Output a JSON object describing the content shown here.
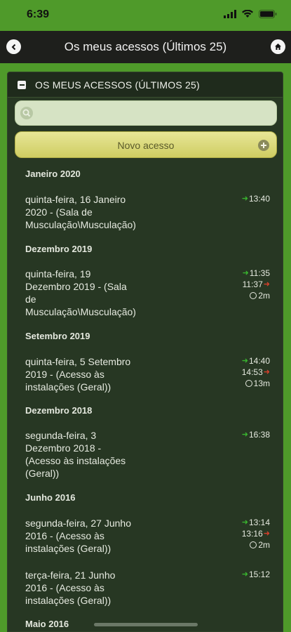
{
  "status": {
    "time": "6:39"
  },
  "nav": {
    "title": "Os meus acessos (Últimos 25)"
  },
  "panel": {
    "title": "OS MEUS ACESSOS (ÚLTIMOS 25)",
    "search_placeholder": "",
    "new_button": "Novo acesso"
  },
  "groups": [
    {
      "label": "Janeiro 2020"
    },
    {
      "label": "Dezembro 2019"
    },
    {
      "label": "Setembro 2019"
    },
    {
      "label": "Dezembro 2018"
    },
    {
      "label": "Junho 2016"
    },
    {
      "label": "Maio 2016"
    }
  ],
  "entries": [
    {
      "lines": [
        "quinta-feira, 16 Janeiro",
        "2020 - (Sala de",
        "Musculação\\Musculação)"
      ],
      "in": "13:40",
      "out": "",
      "duration": ""
    },
    {
      "lines": [
        "quinta-feira, 19",
        "Dezembro 2019 - (Sala",
        "de",
        "Musculação\\Musculação)"
      ],
      "in": "11:35",
      "out": "11:37",
      "duration": "2m"
    },
    {
      "lines": [
        "quinta-feira, 5 Setembro",
        "2019 - (Acesso às",
        "instalações (Geral))"
      ],
      "in": "14:40",
      "out": "14:53",
      "duration": "13m"
    },
    {
      "lines": [
        "segunda-feira, 3",
        "Dezembro 2018 -",
        "(Acesso às instalações",
        "(Geral))"
      ],
      "in": "16:38",
      "out": "",
      "duration": ""
    },
    {
      "lines": [
        "segunda-feira, 27 Junho",
        "2016 - (Acesso às",
        "instalações (Geral))"
      ],
      "in": "13:14",
      "out": "13:16",
      "duration": "2m"
    },
    {
      "lines": [
        "terça-feira, 21 Junho",
        "2016 - (Acesso às",
        "instalações (Geral))"
      ],
      "in": "15:12",
      "out": "",
      "duration": ""
    }
  ],
  "colors": {
    "green": "#4f9a2a",
    "panel": "#273723",
    "arrow_in": "#39b52f",
    "arrow_out": "#d8402c"
  }
}
